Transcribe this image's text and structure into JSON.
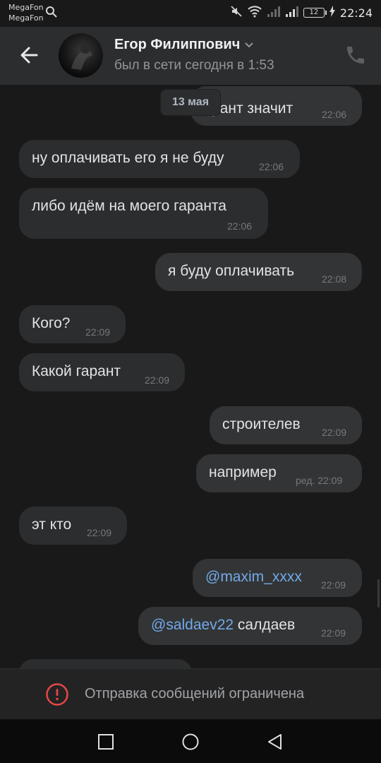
{
  "status_bar": {
    "carrier1": "MegaFon",
    "carrier2": "MegaFon",
    "battery": "12",
    "time": "22:24"
  },
  "header": {
    "contact_name": "Егор Филиппович",
    "last_seen": "был в сети сегодня в 1:53"
  },
  "chat": {
    "date_badge": "13 мая",
    "messages": [
      {
        "text": "рант значит",
        "time": "22:06",
        "direction": "out"
      },
      {
        "text": "ну оплачивать его я не буду",
        "time": "22:06",
        "direction": "in"
      },
      {
        "text": "либо идём на моего гаранта",
        "time": "22:06",
        "direction": "in"
      },
      {
        "text": "я буду оплачивать",
        "time": "22:08",
        "direction": "out"
      },
      {
        "text": "Кого?",
        "time": "22:09",
        "direction": "in"
      },
      {
        "text": "Какой гарант",
        "time": "22:09",
        "direction": "in"
      },
      {
        "text": "строителев",
        "time": "22:09",
        "direction": "out"
      },
      {
        "text": "например",
        "time": "ред. 22:09",
        "direction": "out"
      },
      {
        "text": "эт кто",
        "time": "22:09",
        "direction": "in"
      },
      {
        "text": "@maxim_xxxx",
        "time": "22:09",
        "direction": "out"
      },
      {
        "mention": "@saldaev22",
        "text": " салдаев",
        "time": "22:09",
        "direction": "out"
      }
    ]
  },
  "restriction": {
    "text": "Отправка сообщений ограничена"
  },
  "colors": {
    "background": "#19191a",
    "bubble": "#2c2d2e",
    "mention": "#71aaeb",
    "alert": "#e64646"
  }
}
